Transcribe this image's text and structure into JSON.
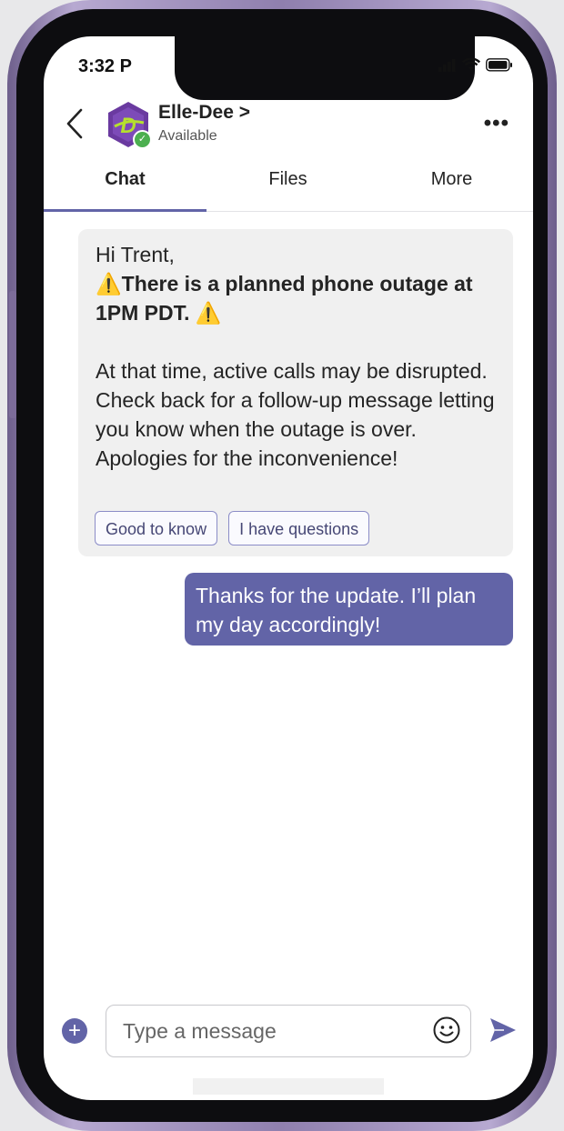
{
  "status_bar": {
    "time": "3:32 P"
  },
  "chat_header": {
    "contact_name": "Elle-Dee",
    "name_chevron": ">",
    "presence": "Available",
    "more_label": "•••"
  },
  "tabs": [
    {
      "label": "Chat",
      "active": true
    },
    {
      "label": "Files",
      "active": false
    },
    {
      "label": "More",
      "active": false
    }
  ],
  "incoming_message": {
    "greeting": "Hi Trent,",
    "warning_icon": "⚠️",
    "headline": "There is a planned phone outage at 1PM PDT.",
    "body": "At that time, active calls may be disrupted. Check back for a follow-up message letting you know when the outage is over. Apologies for the inconvenience!",
    "actions": [
      "Good to know",
      "I have questions"
    ]
  },
  "outgoing_message": {
    "text": "Thanks for the update. I’ll plan my day accordingly!"
  },
  "compose": {
    "placeholder": "Type a message",
    "plus_label": "+"
  },
  "colors": {
    "accent": "#6264a7",
    "incoming_bubble": "#f0f0f0",
    "presence_available": "#4caf50",
    "phone_frame": "#8f7fae"
  }
}
